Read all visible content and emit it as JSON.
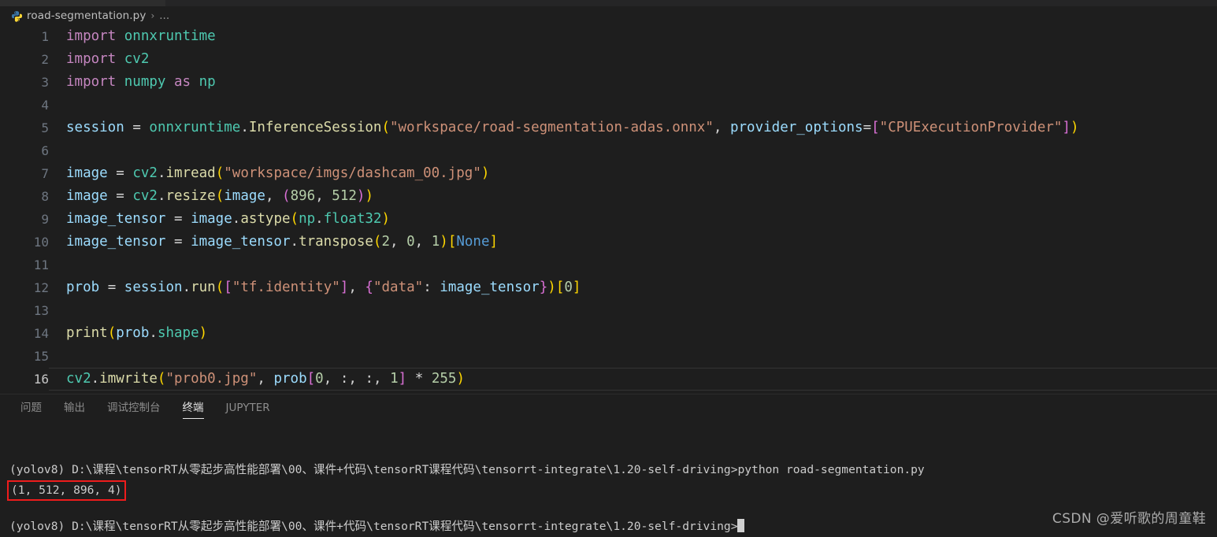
{
  "window": {
    "file_icon": "python-file-icon",
    "breadcrumb_file": "road-segmentation.py",
    "breadcrumb_separator": "›",
    "breadcrumb_dots": "..."
  },
  "editor": {
    "lines": [
      {
        "n": "1",
        "active": false
      },
      {
        "n": "2",
        "active": false
      },
      {
        "n": "3",
        "active": false
      },
      {
        "n": "4",
        "active": false
      },
      {
        "n": "5",
        "active": false
      },
      {
        "n": "6",
        "active": false
      },
      {
        "n": "7",
        "active": false
      },
      {
        "n": "8",
        "active": false
      },
      {
        "n": "9",
        "active": false
      },
      {
        "n": "10",
        "active": false
      },
      {
        "n": "11",
        "active": false
      },
      {
        "n": "12",
        "active": false
      },
      {
        "n": "13",
        "active": false
      },
      {
        "n": "14",
        "active": false
      },
      {
        "n": "15",
        "active": false
      },
      {
        "n": "16",
        "active": true
      }
    ],
    "code": [
      "import onnxruntime",
      "import cv2",
      "import numpy as np",
      "",
      "session = onnxruntime.InferenceSession(\"workspace/road-segmentation-adas.onnx\", provider_options=[\"CPUExecutionProvider\"])",
      "",
      "image = cv2.imread(\"workspace/imgs/dashcam_00.jpg\")",
      "image = cv2.resize(image, (896, 512))",
      "image_tensor = image.astype(np.float32)",
      "image_tensor = image_tensor.transpose(2, 0, 1)[None]",
      "",
      "prob = session.run([\"tf.identity\"], {\"data\": image_tensor})[0]",
      "",
      "print(prob.shape)",
      "",
      "cv2.imwrite(\"prob0.jpg\", prob[0, :, :, 1] * 255)"
    ]
  },
  "panel": {
    "tabs": [
      {
        "label": "问题",
        "active": false
      },
      {
        "label": "输出",
        "active": false
      },
      {
        "label": "调试控制台",
        "active": false
      },
      {
        "label": "终端",
        "active": true
      },
      {
        "label": "JUPYTER",
        "active": false
      }
    ]
  },
  "terminal": {
    "prompt_path": "(yolov8) D:\\课程\\tensorRT从零起步高性能部署\\00、课件+代码\\tensorRT课程代码\\tensorrt-integrate\\1.20-self-driving>",
    "command": "python road-segmentation.py",
    "output": "(1, 512, 896, 4)",
    "highlight_color": "#ee1c1c"
  },
  "watermark": {
    "text": "CSDN @爱听歌的周童鞋"
  }
}
